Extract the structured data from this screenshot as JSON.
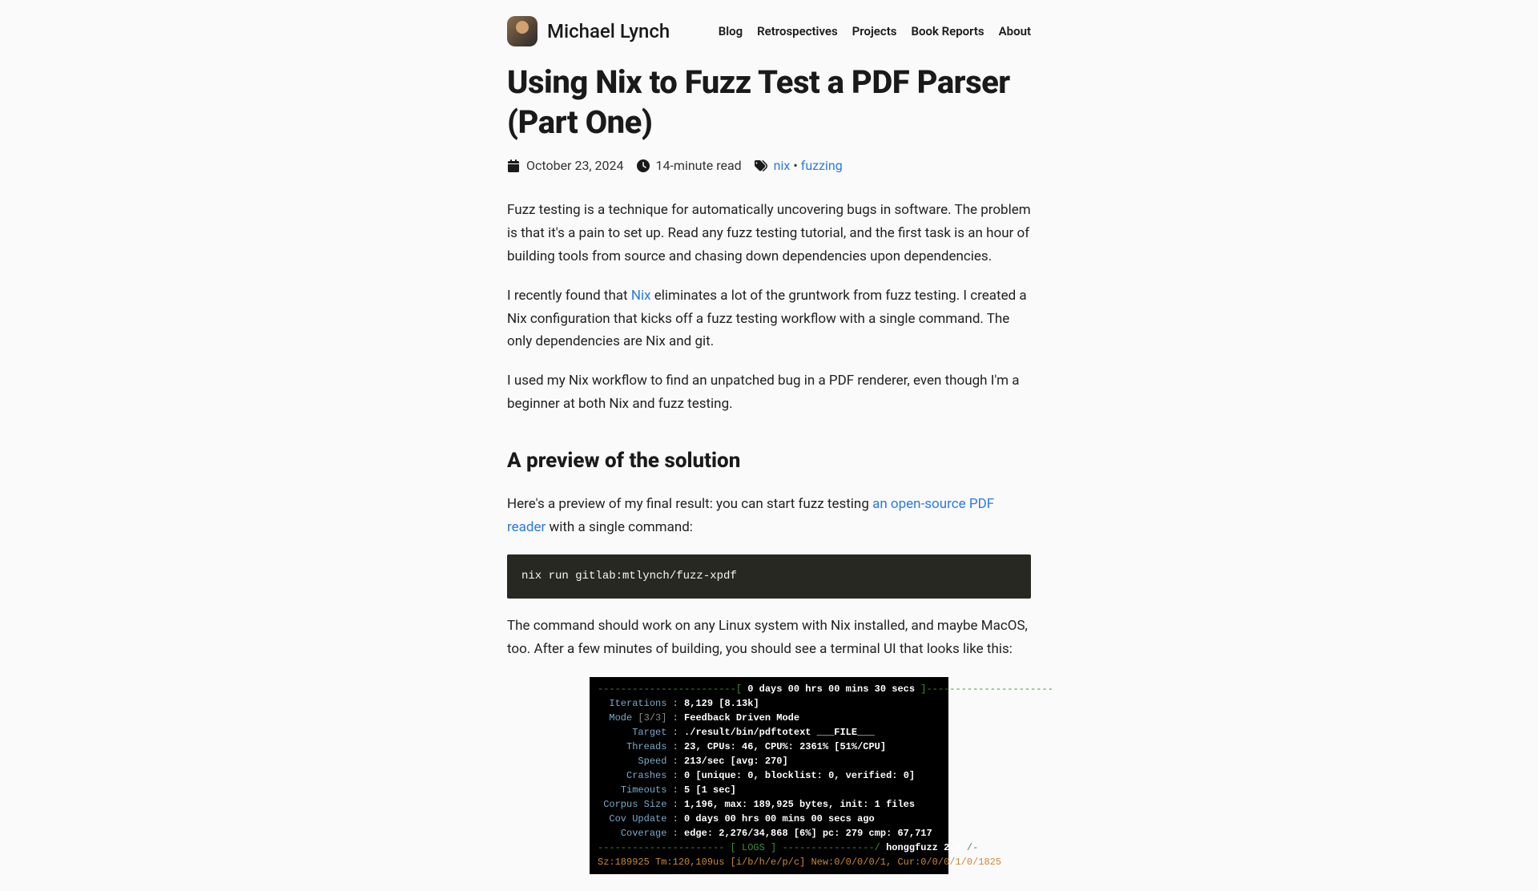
{
  "site": {
    "name": "Michael Lynch",
    "nav": [
      "Blog",
      "Retrospectives",
      "Projects",
      "Book Reports",
      "About"
    ]
  },
  "post": {
    "title": "Using Nix to Fuzz Test a PDF Parser (Part One)",
    "date": "October 23, 2024",
    "read_time": "14-minute read",
    "tags": [
      "nix",
      "fuzzing"
    ]
  },
  "body": {
    "p1": "Fuzz testing is a technique for automatically uncovering bugs in software. The problem is that it's a pain to set up. Read any fuzz testing tutorial, and the first task is an hour of building tools from source and chasing down dependencies upon dependencies.",
    "p2a": "I recently found that ",
    "p2link": "Nix",
    "p2b": " eliminates a lot of the gruntwork from fuzz testing. I created a Nix configuration that kicks off a fuzz testing workflow with a single command. The only dependencies are Nix and git.",
    "p3": "I used my Nix workflow to find an unpatched bug in a PDF renderer, even though I'm a beginner at both Nix and fuzz testing.",
    "h2": "A preview of the solution",
    "p4a": "Here's a preview of my final result: you can start fuzz testing ",
    "p4link": "an open-source PDF reader",
    "p4b": " with a single command:",
    "code": "nix run gitlab:mtlynch/fuzz-xpdf",
    "p5": "The command should work on any Linux system with Nix installed, and maybe MacOS, too. After a few minutes of building, you should see a terminal UI that looks like this:"
  },
  "terminal": {
    "runtime": "0 days 00 hrs 00 mins 30 secs",
    "iterations": "8,129 [8.13k]",
    "mode": "Feedback Driven Mode",
    "mode_n": "[3/3]",
    "target": "./result/bin/pdftotext ___FILE___",
    "threads": "23, CPUs: 46, CPU%: 2361% [51%/CPU]",
    "speed": "213/sec [avg: 270]",
    "crashes": "0 [unique: 0, blocklist: 0, verified: 0]",
    "timeouts": "5 [1 sec]",
    "corpus": "1,196, max: 189,925 bytes, init: 1 files",
    "cov_update": "0 days 00 hrs 00 mins 00 secs ago",
    "coverage": "edge: 2,276/34,868 [6%] pc: 279 cmp: 67,717",
    "logs_label": "honggfuzz 2.6",
    "last": "Sz:189925 Tm:120,109us [i/b/h/e/p/c] New:0/0/0/0/1, Cur:0/0/0/1/0/1825"
  }
}
